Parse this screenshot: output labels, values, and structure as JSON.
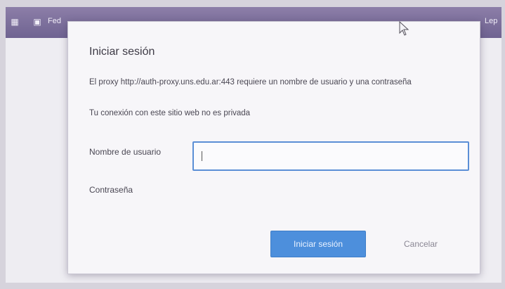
{
  "browser": {
    "toolbar_left_text": "Fed",
    "toolbar_right_text": "Lep",
    "toolbar_icons": [
      "grid-icon",
      "image-icon"
    ]
  },
  "dialog": {
    "title": "Iniciar sesión",
    "message": "El proxy http://auth-proxy.uns.edu.ar:443 requiere un nombre de usuario y una contraseña",
    "privacy_notice": "Tu conexión con este sitio web no es privada",
    "username_label": "Nombre de usuario",
    "username_value": "",
    "password_label": "Contraseña",
    "login_button": "Iniciar sesión",
    "cancel_button": "Cancelar"
  },
  "colors": {
    "toolbar": "#7a6d9c",
    "primary_button": "#4d8fdc",
    "input_focus_border": "#5b8fd6"
  }
}
